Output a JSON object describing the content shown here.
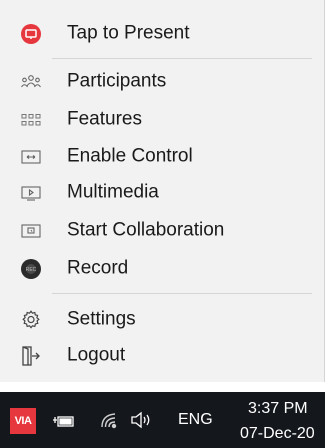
{
  "menu": {
    "items": [
      {
        "label": "Tap to Present",
        "icon": "present-icon"
      },
      {
        "label": "Participants",
        "icon": "participants-icon"
      },
      {
        "label": "Features",
        "icon": "features-icon"
      },
      {
        "label": "Enable Control",
        "icon": "enable-control-icon"
      },
      {
        "label": "Multimedia",
        "icon": "multimedia-icon"
      },
      {
        "label": "Start Collaboration",
        "icon": "collaboration-icon"
      },
      {
        "label": "Record",
        "icon": "record-icon"
      },
      {
        "label": "Settings",
        "icon": "gear-icon"
      },
      {
        "label": "Logout",
        "icon": "logout-icon"
      }
    ]
  },
  "taskbar": {
    "app_logo_text": "VIA",
    "language": "ENG",
    "time": "3:37 PM",
    "date": "07-Dec-20"
  },
  "colors": {
    "present_red": "#e5373d",
    "taskbar_bg": "#14181d",
    "menu_bg": "#f2f2f2"
  }
}
